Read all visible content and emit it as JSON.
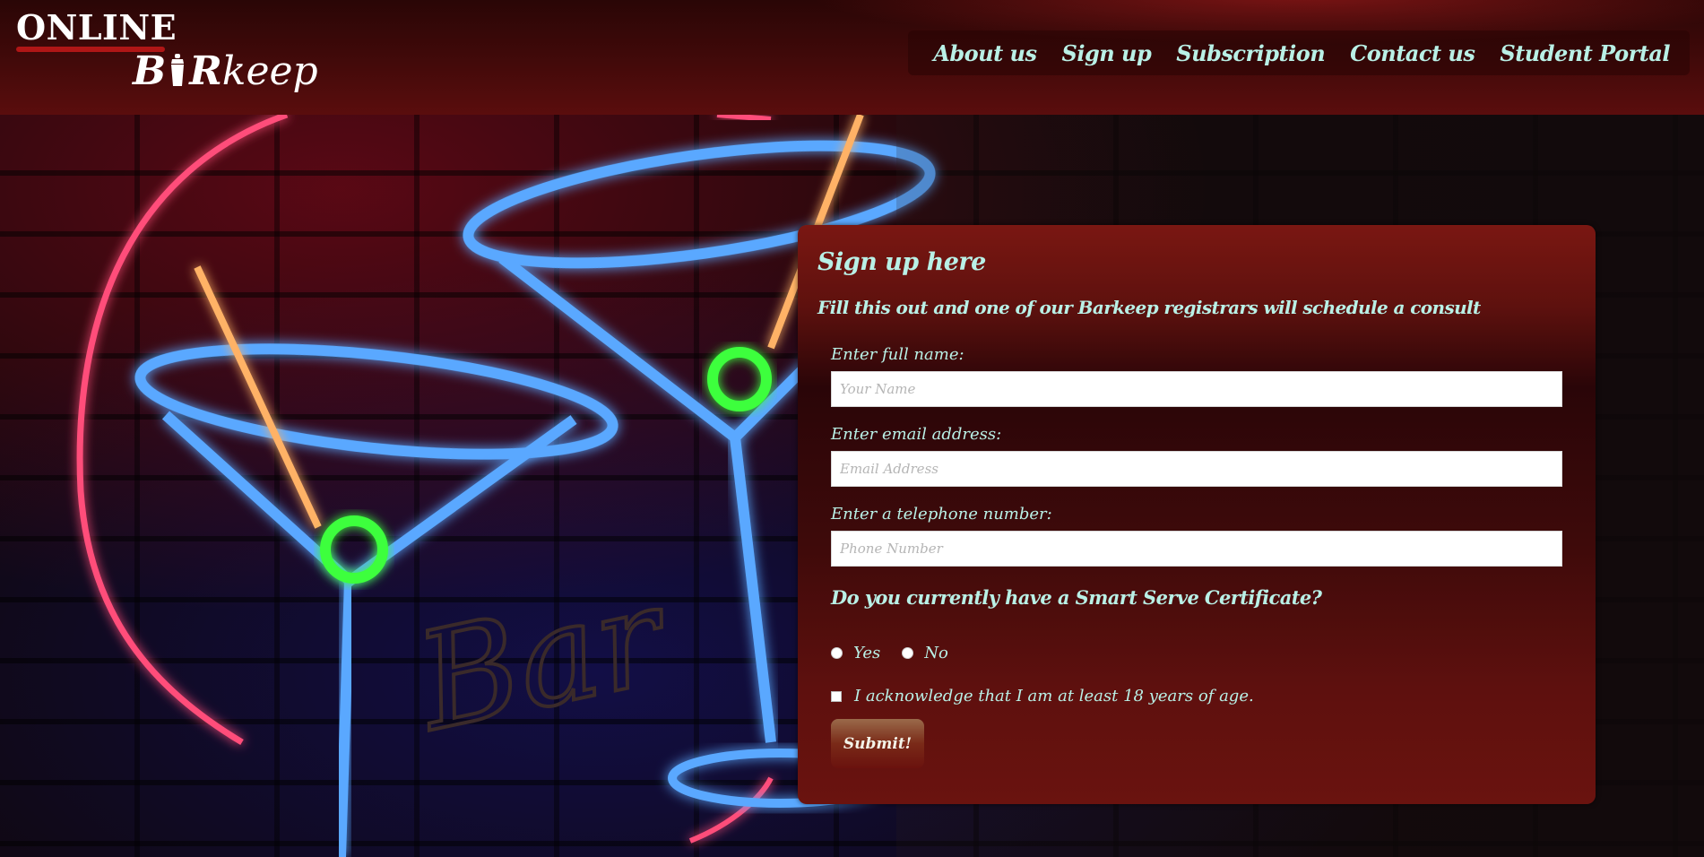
{
  "logo": {
    "top_text": "ONLINE",
    "bottom_b": "B",
    "bottom_r": "R",
    "bottom_rest": "keep"
  },
  "nav": {
    "items": [
      {
        "label": "About us"
      },
      {
        "label": "Sign up"
      },
      {
        "label": "Subscription"
      },
      {
        "label": "Contact us"
      },
      {
        "label": "Student Portal"
      }
    ]
  },
  "form": {
    "title": "Sign up here",
    "subtitle": "Fill this out and one of our Barkeep registrars will schedule a consult",
    "name_label": "Enter full name:",
    "name_placeholder": "Your Name",
    "name_value": "",
    "email_label": "Enter email address:",
    "email_placeholder": "Email Address",
    "email_value": "",
    "phone_label": "Enter a telephone number:",
    "phone_placeholder": "Phone Number",
    "phone_value": "",
    "certificate_question": "Do you currently have a Smart Serve Certificate?",
    "option_yes": "Yes",
    "option_no": "No",
    "age_acknowledgement": "I acknowledge that I am at least 18 years of age.",
    "submit_label": "Submit!"
  },
  "background": {
    "neon_sign_text": "Bar"
  },
  "colors": {
    "header_bg": "#3e0909",
    "panel_bg": "#5e110e",
    "accent_text": "#b9f0e6",
    "logo_red": "#b01616"
  }
}
